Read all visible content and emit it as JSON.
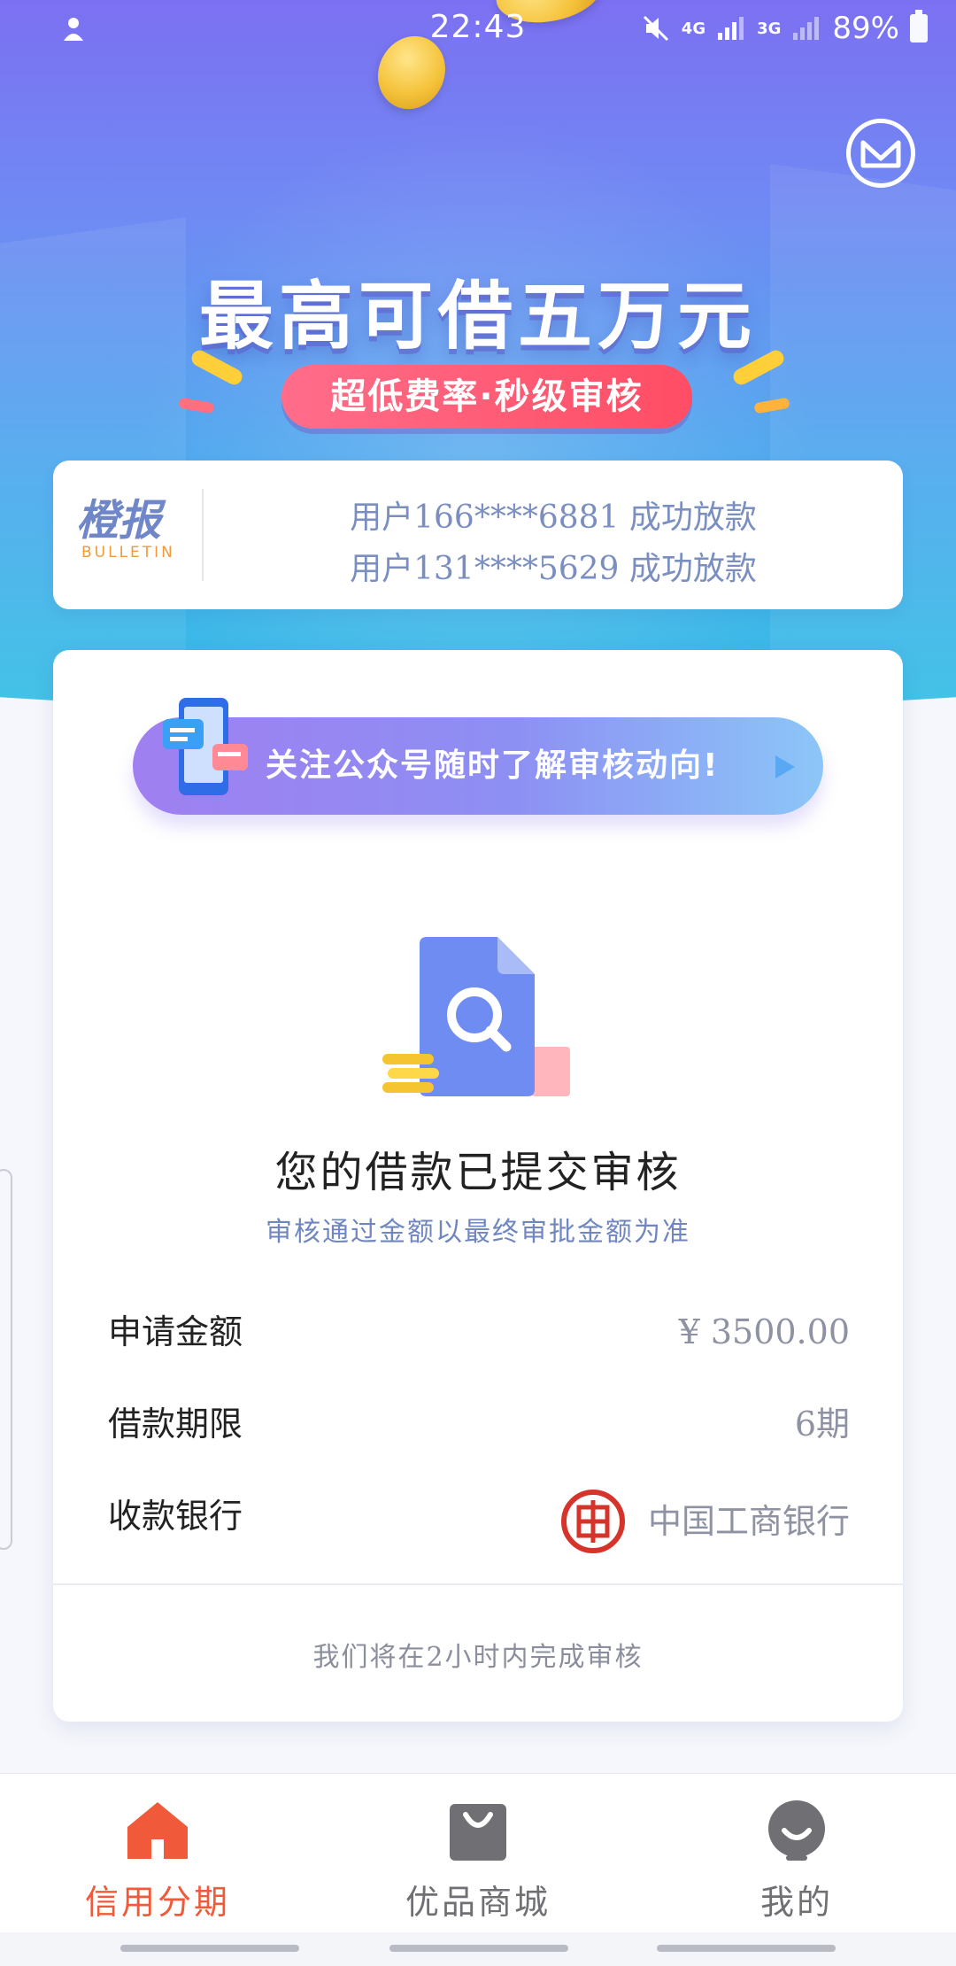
{
  "status_bar": {
    "time": "22:43",
    "network_4g": "4G",
    "network_3g": "3G",
    "battery": "89%"
  },
  "hero": {
    "title": "最高可借五万元",
    "pill": "超低费率·秒级审核"
  },
  "bulletin": {
    "logo_main": "橙报",
    "logo_sub": "BULLETIN",
    "lines": [
      "用户166****6881 成功放款",
      "用户131****5629 成功放款"
    ]
  },
  "follow_banner": {
    "text": "关注公众号随时了解审核动向!"
  },
  "review": {
    "title": "您的借款已提交审核",
    "subtitle": "审核通过金额以最终审批金额为准"
  },
  "details": {
    "amount_label": "申请金额",
    "amount_value": "¥ 3500.00",
    "term_label": "借款期限",
    "term_value": "6期",
    "bank_label": "收款银行",
    "bank_value": "中国工商银行"
  },
  "footer_note": "我们将在2小时内完成审核",
  "bottom_nav": {
    "items": [
      {
        "label": "信用分期",
        "icon": "home-icon",
        "active": true
      },
      {
        "label": "优品商城",
        "icon": "shopping-bag-icon",
        "active": false
      },
      {
        "label": "我的",
        "icon": "profile-icon",
        "active": false
      }
    ]
  },
  "colors": {
    "accent": "#f05a3a",
    "hero_top": "#7c70f2",
    "hero_bottom": "#33c0e5",
    "link_blue": "#6f86c0"
  }
}
